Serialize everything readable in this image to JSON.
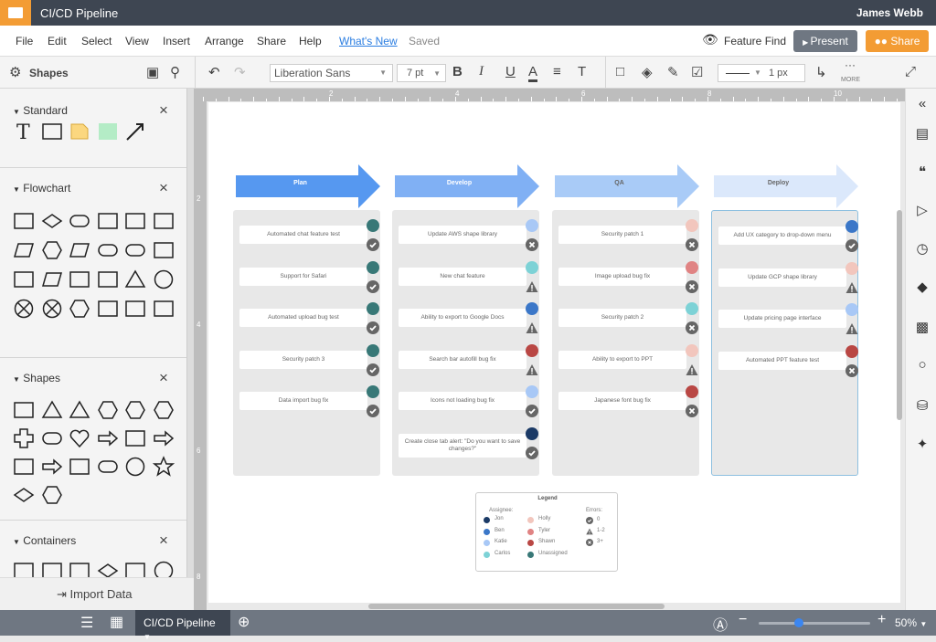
{
  "app": {
    "title": "CI/CD Pipeline",
    "user": "James Webb"
  },
  "menu": {
    "items": [
      "File",
      "Edit",
      "Select",
      "View",
      "Insert",
      "Arrange",
      "Share",
      "Help"
    ],
    "whats_new": "What's New",
    "saved": "Saved",
    "feature_find": "Feature Find",
    "present": "Present",
    "share": "Share"
  },
  "toolbar": {
    "shapes_label": "Shapes",
    "font": "Liberation Sans",
    "font_size": "7 pt",
    "line_width": "1 px",
    "more": "MORE"
  },
  "panel": {
    "sections": [
      "Standard",
      "Flowchart",
      "Shapes",
      "Containers"
    ],
    "import": "Import Data"
  },
  "ruler": {
    "top": [
      "2",
      "4",
      "6",
      "8",
      "10"
    ],
    "left": [
      "2",
      "4",
      "6",
      "8"
    ]
  },
  "colors": {
    "Jon": "#1b3a66",
    "Ben": "#3b77c8",
    "Katie": "#a8c8f6",
    "Carlos": "#7dd2d6",
    "Holly": "#f2c6bd",
    "Tyler": "#e08383",
    "Shawn": "#b94744",
    "Unassigned": "#387877"
  },
  "columns": [
    {
      "title": "Plan",
      "arrow": "#5698f0",
      "text": "#fff",
      "cards": [
        {
          "text": "Automated chat feature test",
          "who": "Unassigned",
          "err": "0"
        },
        {
          "text": "Support for Safari",
          "who": "Unassigned",
          "err": "0"
        },
        {
          "text": "Automated upload bug test",
          "who": "Unassigned",
          "err": "0"
        },
        {
          "text": "Security patch 3",
          "who": "Unassigned",
          "err": "0"
        },
        {
          "text": "Data import bug fix",
          "who": "Unassigned",
          "err": "0"
        }
      ]
    },
    {
      "title": "Develop",
      "arrow": "#80b0f4",
      "text": "#fff",
      "cards": [
        {
          "text": "Update AWS shape library",
          "who": "Katie",
          "err": "3+"
        },
        {
          "text": "New chat feature",
          "who": "Carlos",
          "err": "1-2"
        },
        {
          "text": "Ability to export to Google Docs",
          "who": "Ben",
          "err": "1-2"
        },
        {
          "text": "Search bar autofill bug fix",
          "who": "Shawn",
          "err": "1-2"
        },
        {
          "text": "Icons not loading bug fix",
          "who": "Katie",
          "err": "0"
        },
        {
          "text": "Create close tab alert: \"Do you want to save changes?\"",
          "who": "Jon",
          "err": "0"
        }
      ]
    },
    {
      "title": "QA",
      "arrow": "#a9cbf7",
      "text": "#666",
      "cards": [
        {
          "text": "Security patch 1",
          "who": "Holly",
          "err": "3+"
        },
        {
          "text": "Image upload bug fix",
          "who": "Tyler",
          "err": "3+"
        },
        {
          "text": "Security patch 2",
          "who": "Carlos",
          "err": "3+"
        },
        {
          "text": "Ability to export to PPT",
          "who": "Holly",
          "err": "1-2"
        },
        {
          "text": "Japanese font bug fix",
          "who": "Shawn",
          "err": "3+"
        }
      ]
    },
    {
      "title": "Deploy",
      "arrow": "#dbe8fb",
      "text": "#666",
      "cards": [
        {
          "text": "Add UX category to drop-down menu",
          "who": "Ben",
          "err": "0"
        },
        {
          "text": "Update GCP shape library",
          "who": "Holly",
          "err": "1-2"
        },
        {
          "text": "Update pricing page interface",
          "who": "Katie",
          "err": "1-2"
        },
        {
          "text": "Automated PPT feature test",
          "who": "Shawn",
          "err": "3+"
        }
      ]
    }
  ],
  "legend": {
    "title": "Legend",
    "assignee_label": "Assignee:",
    "errors_label": "Errors:",
    "col1": [
      "Jon",
      "Ben",
      "Katie",
      "Carlos"
    ],
    "col2": [
      "Holly",
      "Tyler",
      "Shawn",
      "Unassigned"
    ],
    "errors": [
      "0",
      "1-2",
      "3+"
    ]
  },
  "bottom": {
    "page_tab": "CI/CD Pipeline",
    "zoom": "50%",
    "zoom_fraction": 0.35
  }
}
